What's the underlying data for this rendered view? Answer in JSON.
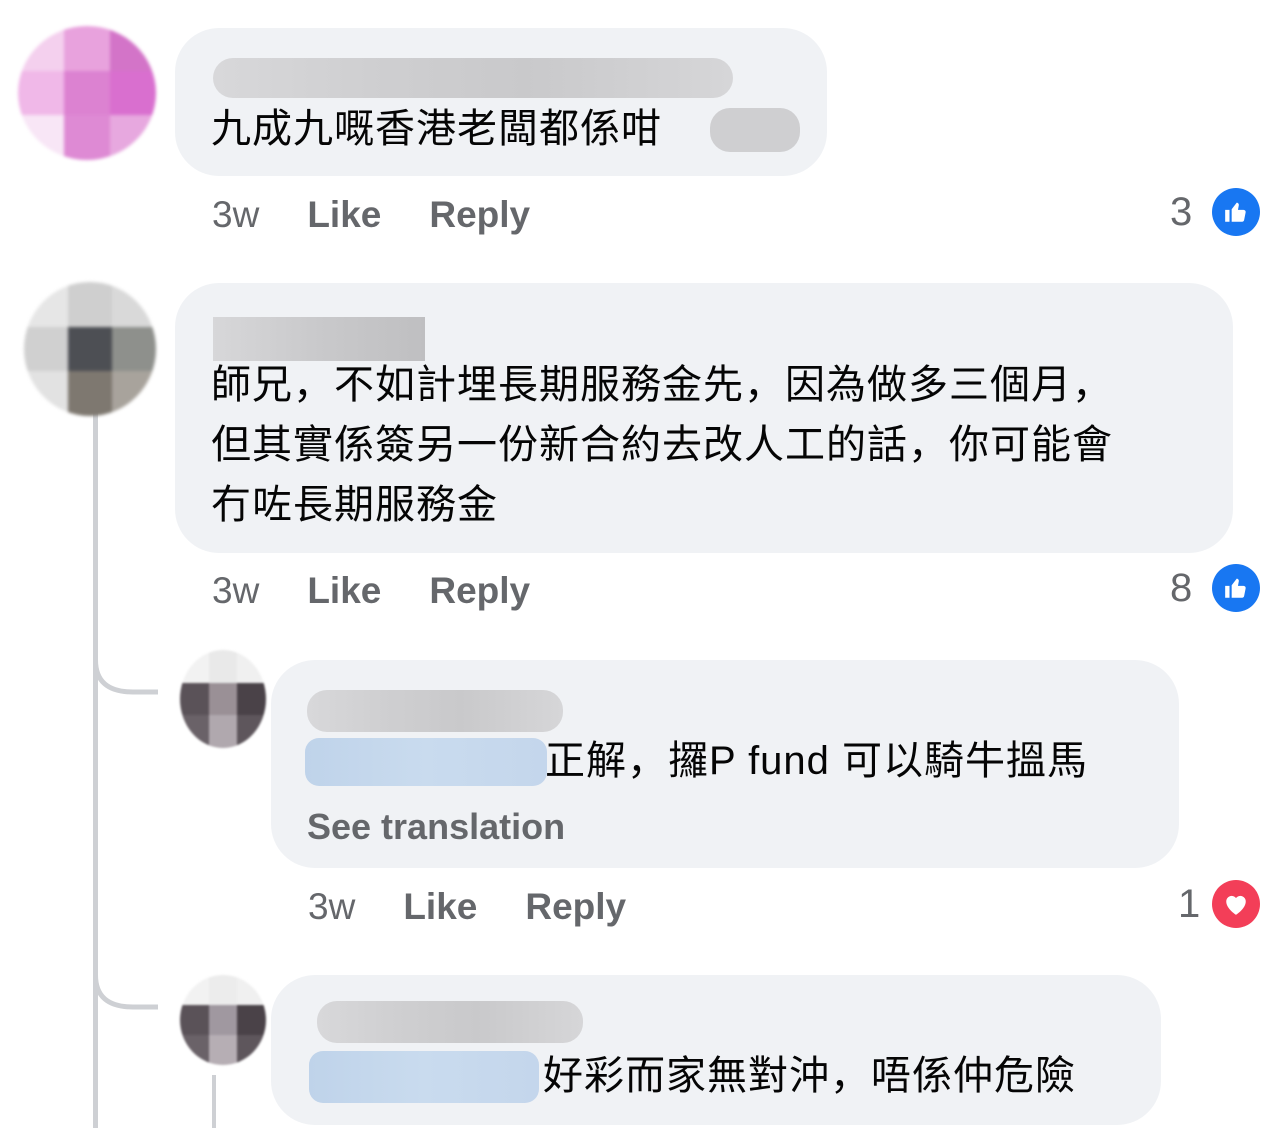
{
  "comments": [
    {
      "text_lines": [
        "九成九嘅香港老闆都係咁"
      ],
      "time": "3w",
      "like_label": "Like",
      "reply_label": "Reply",
      "reaction_count": "3",
      "reaction_type": "like-icon"
    },
    {
      "text_lines": [
        "師兄，不如計埋長期服務金先，因為做多三個月，",
        "但其實係簽另一份新合約去改人工的話，你可能會",
        "冇咗長期服務金"
      ],
      "time": "3w",
      "like_label": "Like",
      "reply_label": "Reply",
      "reaction_count": "8",
      "reaction_type": "like-icon"
    }
  ],
  "replies": [
    {
      "text": "正解，攞P fund 可以騎牛搵馬",
      "see_translation": "See translation",
      "time": "3w",
      "like_label": "Like",
      "reply_label": "Reply",
      "reaction_count": "1",
      "reaction_type": "love-icon"
    },
    {
      "text": "好彩而家無對沖，唔係仲危險"
    }
  ],
  "colors": {
    "bubble": "#f0f2f5",
    "meta": "#65676b",
    "like": "#1877f2",
    "love": "#f33e58",
    "thread": "#ced0d4"
  }
}
